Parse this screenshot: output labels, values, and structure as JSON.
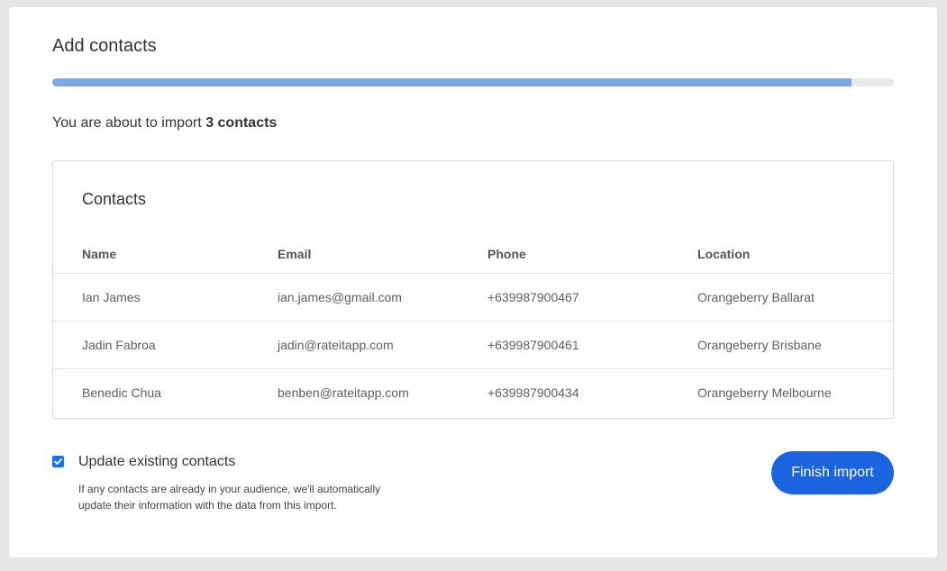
{
  "title": "Add contacts",
  "progress": {
    "fraction": 0.95
  },
  "summary": {
    "prefix": "You are about to import ",
    "count_text": "3 contacts"
  },
  "contacts": {
    "title": "Contacts",
    "columns": [
      "Name",
      "Email",
      "Phone",
      "Location"
    ],
    "rows": [
      [
        "Ian James",
        "ian.james@gmail.com",
        "+639987900467",
        "Orangeberry Ballarat"
      ],
      [
        "Jadin Fabroa",
        "jadin@rateitapp.com",
        "+639987900461",
        "Orangeberry Brisbane"
      ],
      [
        "Benedic Chua",
        "benben@rateitapp.com",
        "+639987900434",
        "Orangeberry Melbourne"
      ]
    ]
  },
  "update_existing": {
    "checked": true,
    "label": "Update existing contacts",
    "help": "If any contacts are already in your audience, we'll automatically update their information with the data from this import."
  },
  "finish_button": {
    "label": "Finish import"
  },
  "colors": {
    "accent": "#1a64e0",
    "progress": "#79a8e6",
    "background": "#e6e6e6"
  }
}
